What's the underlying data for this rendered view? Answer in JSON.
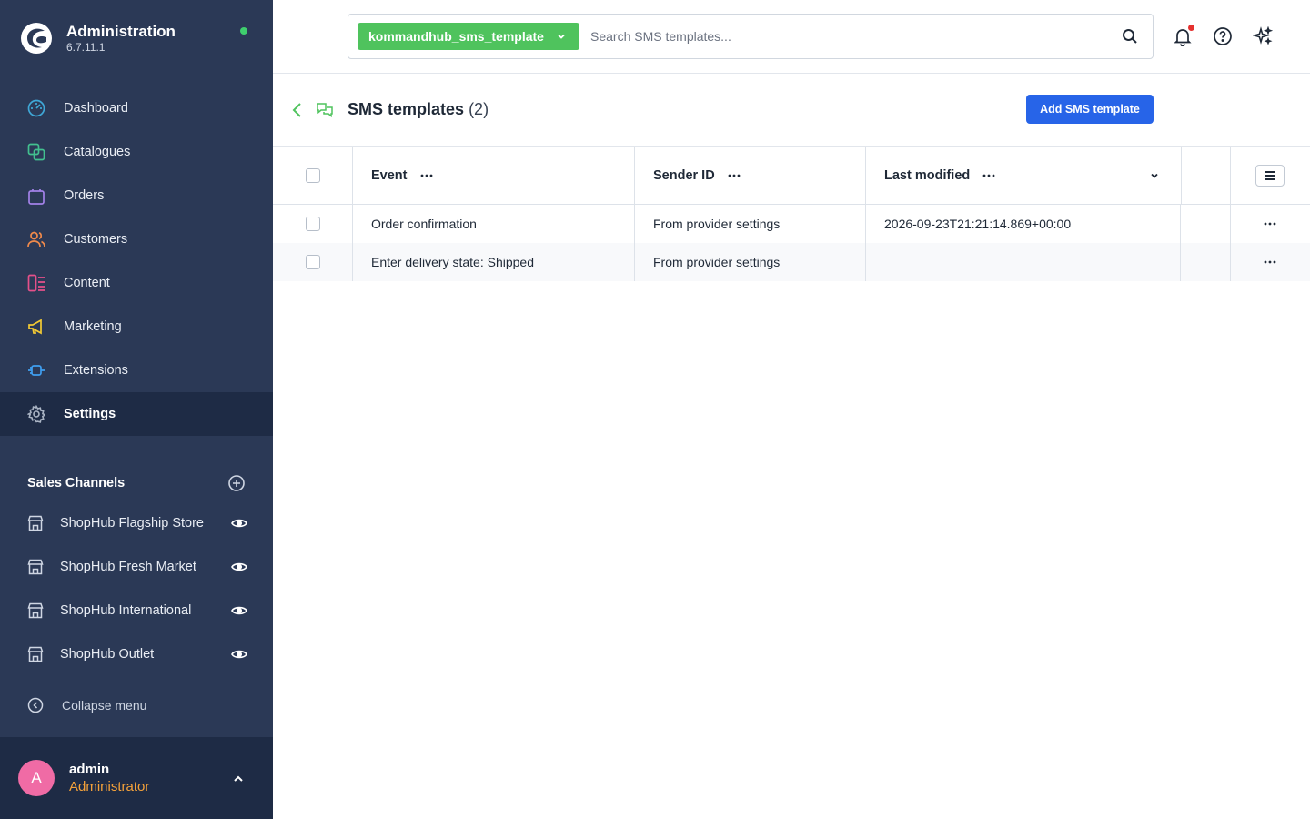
{
  "brand": {
    "title": "Administration",
    "version": "6.7.11.1"
  },
  "nav": [
    {
      "label": "Dashboard",
      "icon": "dashboard-icon",
      "color": "#3fa7d6"
    },
    {
      "label": "Catalogues",
      "icon": "catalogue-icon",
      "color": "#42c08f"
    },
    {
      "label": "Orders",
      "icon": "orders-bag-icon",
      "color": "#a281e8"
    },
    {
      "label": "Customers",
      "icon": "customers-icon",
      "color": "#f08a4b"
    },
    {
      "label": "Content",
      "icon": "content-icon",
      "color": "#e5508a"
    },
    {
      "label": "Marketing",
      "icon": "megaphone-icon",
      "color": "#f2c934"
    },
    {
      "label": "Extensions",
      "icon": "plug-icon",
      "color": "#3f9ef0"
    },
    {
      "label": "Settings",
      "icon": "gear-icon",
      "color": "#aab4c4",
      "active": true
    }
  ],
  "sales_channels": {
    "title": "Sales Channels",
    "items": [
      {
        "label": "ShopHub Flagship Store"
      },
      {
        "label": "ShopHub Fresh Market"
      },
      {
        "label": "ShopHub International"
      },
      {
        "label": "ShopHub Outlet"
      }
    ]
  },
  "collapse_label": "Collapse menu",
  "user": {
    "initial": "A",
    "name": "admin",
    "role": "Administrator"
  },
  "search": {
    "chip": "kommandhub_sms_template",
    "placeholder": "Search SMS templates..."
  },
  "page": {
    "title": "SMS templates",
    "count": "(2)",
    "add_button": "Add SMS template"
  },
  "table": {
    "columns": [
      "Event",
      "Sender ID",
      "Last modified"
    ],
    "rows": [
      {
        "event": "Order confirmation",
        "sender": "From provider settings",
        "modified": "2026-09-23T21:21:14.869+00:00"
      },
      {
        "event": "Enter delivery state: Shipped",
        "sender": "From provider settings",
        "modified": ""
      }
    ]
  },
  "colors": {
    "sidebar": "#2b3956",
    "accent": "#2764e8",
    "chip": "#4fc35d"
  }
}
